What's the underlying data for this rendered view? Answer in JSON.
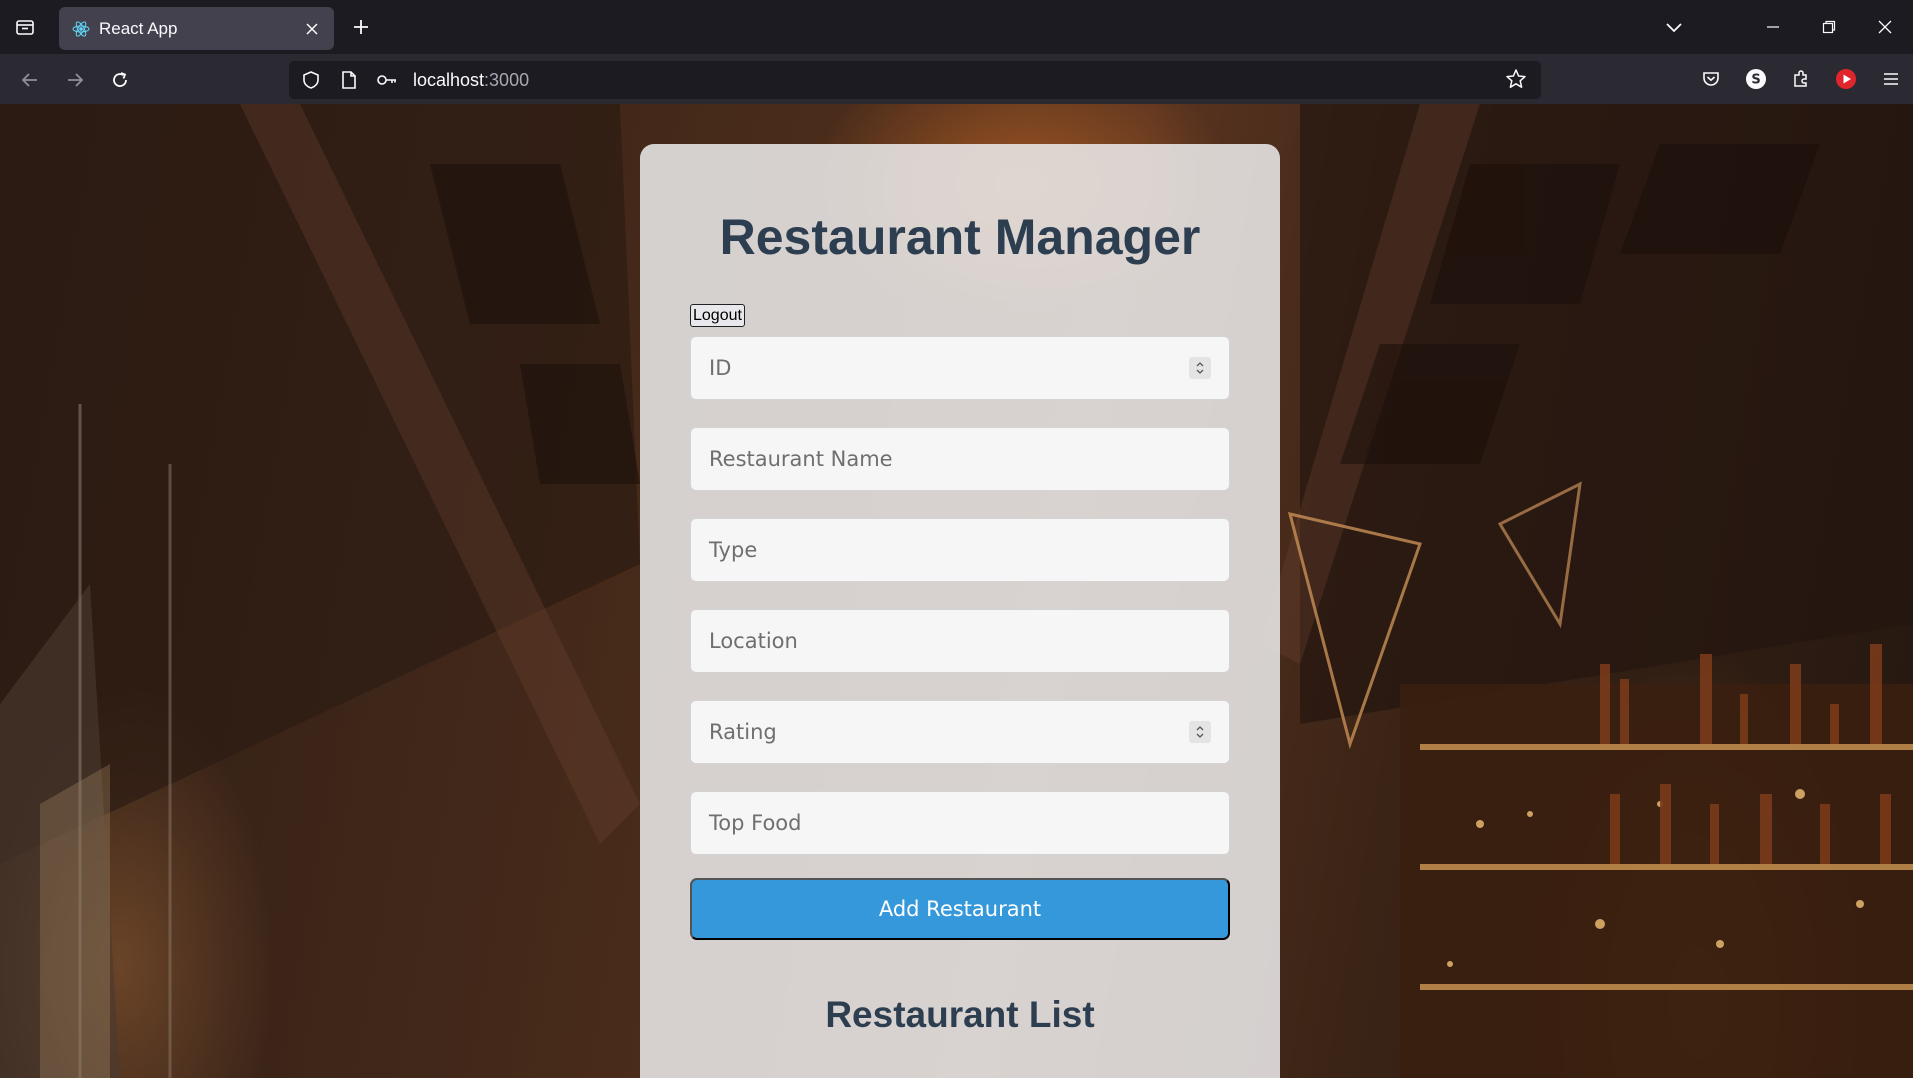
{
  "browser": {
    "tab_title": "React App",
    "url_host": "localhost",
    "url_port": ":3000"
  },
  "page": {
    "title": "Restaurant Manager",
    "logout_label": "Logout",
    "fields": {
      "id_placeholder": "ID",
      "name_placeholder": "Restaurant Name",
      "type_placeholder": "Type",
      "location_placeholder": "Location",
      "rating_placeholder": "Rating",
      "top_food_placeholder": "Top Food"
    },
    "add_button_label": "Add Restaurant",
    "list_title": "Restaurant List"
  },
  "colors": {
    "accent": "#3498db",
    "heading": "#2c3e50"
  }
}
